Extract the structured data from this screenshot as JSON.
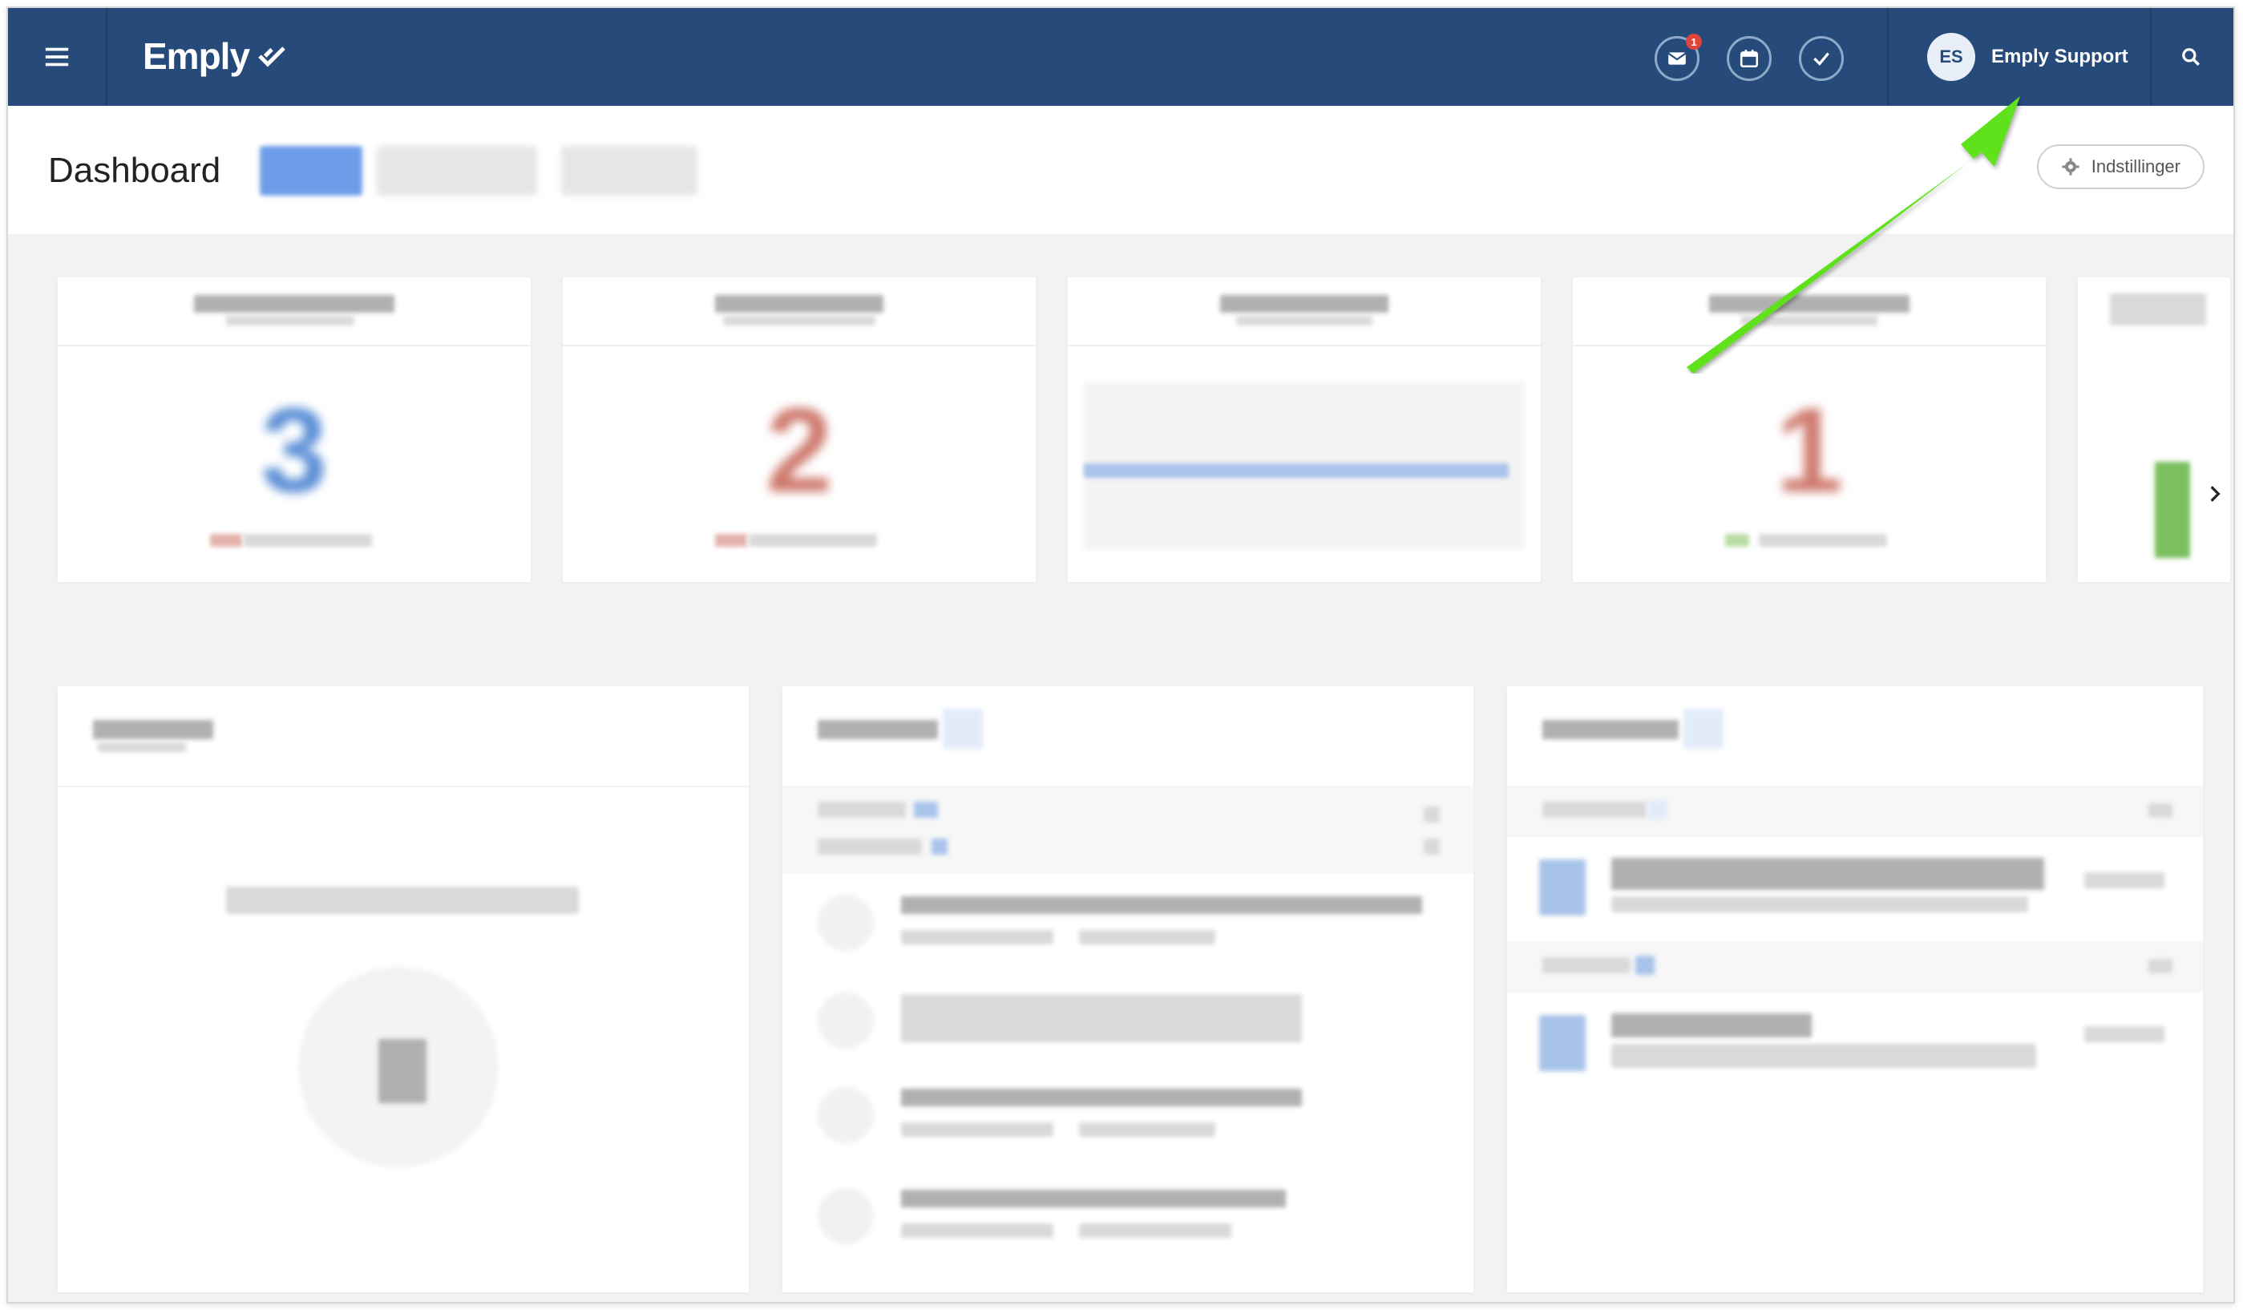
{
  "app": {
    "name": "Emply"
  },
  "topbar": {
    "menu_icon": "hamburger-icon",
    "icons": [
      {
        "name": "mail-icon",
        "badge": "1"
      },
      {
        "name": "calendar-icon"
      },
      {
        "name": "check-icon"
      }
    ],
    "user": {
      "initials": "ES",
      "name": "Emply Support"
    },
    "search_icon": "search-icon"
  },
  "header": {
    "title": "Dashboard",
    "settings_label": "Indstillinger",
    "settings_icon": "gear-icon"
  },
  "kpis": [
    {
      "value": "3",
      "color": "#5b8fd6"
    },
    {
      "value": "2",
      "color": "#cf7a6e"
    },
    {
      "value": "",
      "color": "#a8c3ea"
    },
    {
      "value": "1",
      "color": "#cf7a6e"
    }
  ],
  "annotation": {
    "color": "#5ee11c"
  }
}
